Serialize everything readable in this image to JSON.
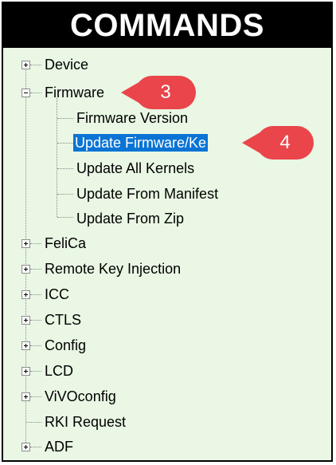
{
  "header": {
    "title": "COMMANDS"
  },
  "tree": {
    "items": [
      {
        "label": "Device",
        "expander": "plus"
      },
      {
        "label": "Firmware",
        "expander": "minus"
      },
      {
        "label": "Firmware Version"
      },
      {
        "label": "Update Firmware/Ke",
        "selected": true
      },
      {
        "label": "Update All Kernels"
      },
      {
        "label": "Update From Manifest"
      },
      {
        "label": "Update From Zip"
      },
      {
        "label": "FeliCa",
        "expander": "plus"
      },
      {
        "label": "Remote Key Injection",
        "expander": "plus"
      },
      {
        "label": "ICC",
        "expander": "plus"
      },
      {
        "label": "CTLS",
        "expander": "plus"
      },
      {
        "label": "Config",
        "expander": "plus"
      },
      {
        "label": "LCD",
        "expander": "plus"
      },
      {
        "label": "ViVOconfig",
        "expander": "plus"
      },
      {
        "label": "RKI Request"
      },
      {
        "label": "ADF",
        "expander": "plus"
      }
    ]
  },
  "callouts": {
    "step3": "3",
    "step4": "4"
  },
  "colors": {
    "panel_bg": "#e9f7e4",
    "selection": "#0a74d4",
    "callout": "#e9454a"
  }
}
